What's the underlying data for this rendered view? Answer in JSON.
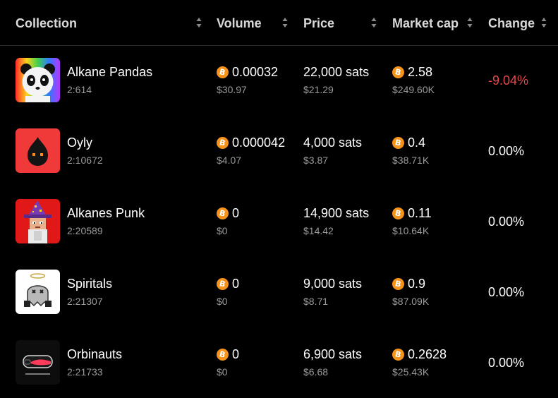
{
  "table": {
    "columns": {
      "collection": "Collection",
      "volume": "Volume",
      "price": "Price",
      "market_cap": "Market cap",
      "change": "Change"
    },
    "rows": [
      {
        "name": "Alkane Pandas",
        "id": "2:614",
        "icon": "panda-avatar",
        "volume_btc": "0.00032",
        "volume_usd": "$30.97",
        "price_sats": "22,000 sats",
        "price_usd": "$21.29",
        "market_cap_btc": "2.58",
        "market_cap_usd": "$249.60K",
        "change": "-9.04%"
      },
      {
        "name": "Oyly",
        "id": "2:10672",
        "icon": "oil-drop-creature-avatar",
        "volume_btc": "0.000042",
        "volume_usd": "$4.07",
        "price_sats": "4,000 sats",
        "price_usd": "$3.87",
        "market_cap_btc": "0.4",
        "market_cap_usd": "$38.71K",
        "change": "0.00%"
      },
      {
        "name": "Alkanes Punk",
        "id": "2:20589",
        "icon": "pixel-wizard-punk-avatar",
        "volume_btc": "0",
        "volume_usd": "$0",
        "price_sats": "14,900 sats",
        "price_usd": "$14.42",
        "market_cap_btc": "0.11",
        "market_cap_usd": "$10.64K",
        "change": "0.00%"
      },
      {
        "name": "Spiritals",
        "id": "2:21307",
        "icon": "ghost-with-halo-avatar",
        "volume_btc": "0",
        "volume_usd": "$0",
        "price_sats": "9,000 sats",
        "price_usd": "$8.71",
        "market_cap_btc": "0.9",
        "market_cap_usd": "$87.09K",
        "change": "0.00%"
      },
      {
        "name": "Orbinauts",
        "id": "2:21733",
        "icon": "orbinauts-capsule-avatar",
        "volume_btc": "0",
        "volume_usd": "$0",
        "price_sats": "6,900 sats",
        "price_usd": "$6.68",
        "market_cap_btc": "0.2628",
        "market_cap_usd": "$25.43K",
        "change": "0.00%"
      }
    ]
  },
  "colors": {
    "background": "#000000",
    "negative_change": "#e5484d",
    "neutral_change": "#ffffff",
    "bitcoin": "#f7931a",
    "muted_text": "#9a9a9a"
  },
  "icons": {
    "currency": "bitcoin-icon",
    "sort": "sort-icon"
  }
}
